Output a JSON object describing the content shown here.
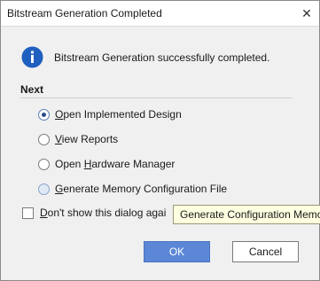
{
  "window": {
    "title": "Bitstream Generation Completed"
  },
  "message": "Bitstream Generation successfully completed.",
  "icon": "info-icon",
  "section_label": "Next",
  "options": [
    {
      "prefix": "",
      "underline": "O",
      "rest": "pen Implemented Design",
      "checked": true
    },
    {
      "prefix": "",
      "underline": "V",
      "rest": "iew Reports",
      "checked": false
    },
    {
      "prefix": "Open ",
      "underline": "H",
      "rest": "ardware Manager",
      "checked": false
    },
    {
      "prefix": "",
      "underline": "G",
      "rest": "enerate Memory Configuration File",
      "checked": false
    }
  ],
  "dont_show": {
    "underline": "D",
    "rest": "on't show this dialog agai"
  },
  "tooltip": "Generate Configuration Memo",
  "buttons": {
    "ok": "OK",
    "cancel": "Cancel"
  },
  "colors": {
    "accent": "#5b87d6",
    "icon": "#1f5fbf",
    "tooltip_bg": "#ffffe1"
  }
}
